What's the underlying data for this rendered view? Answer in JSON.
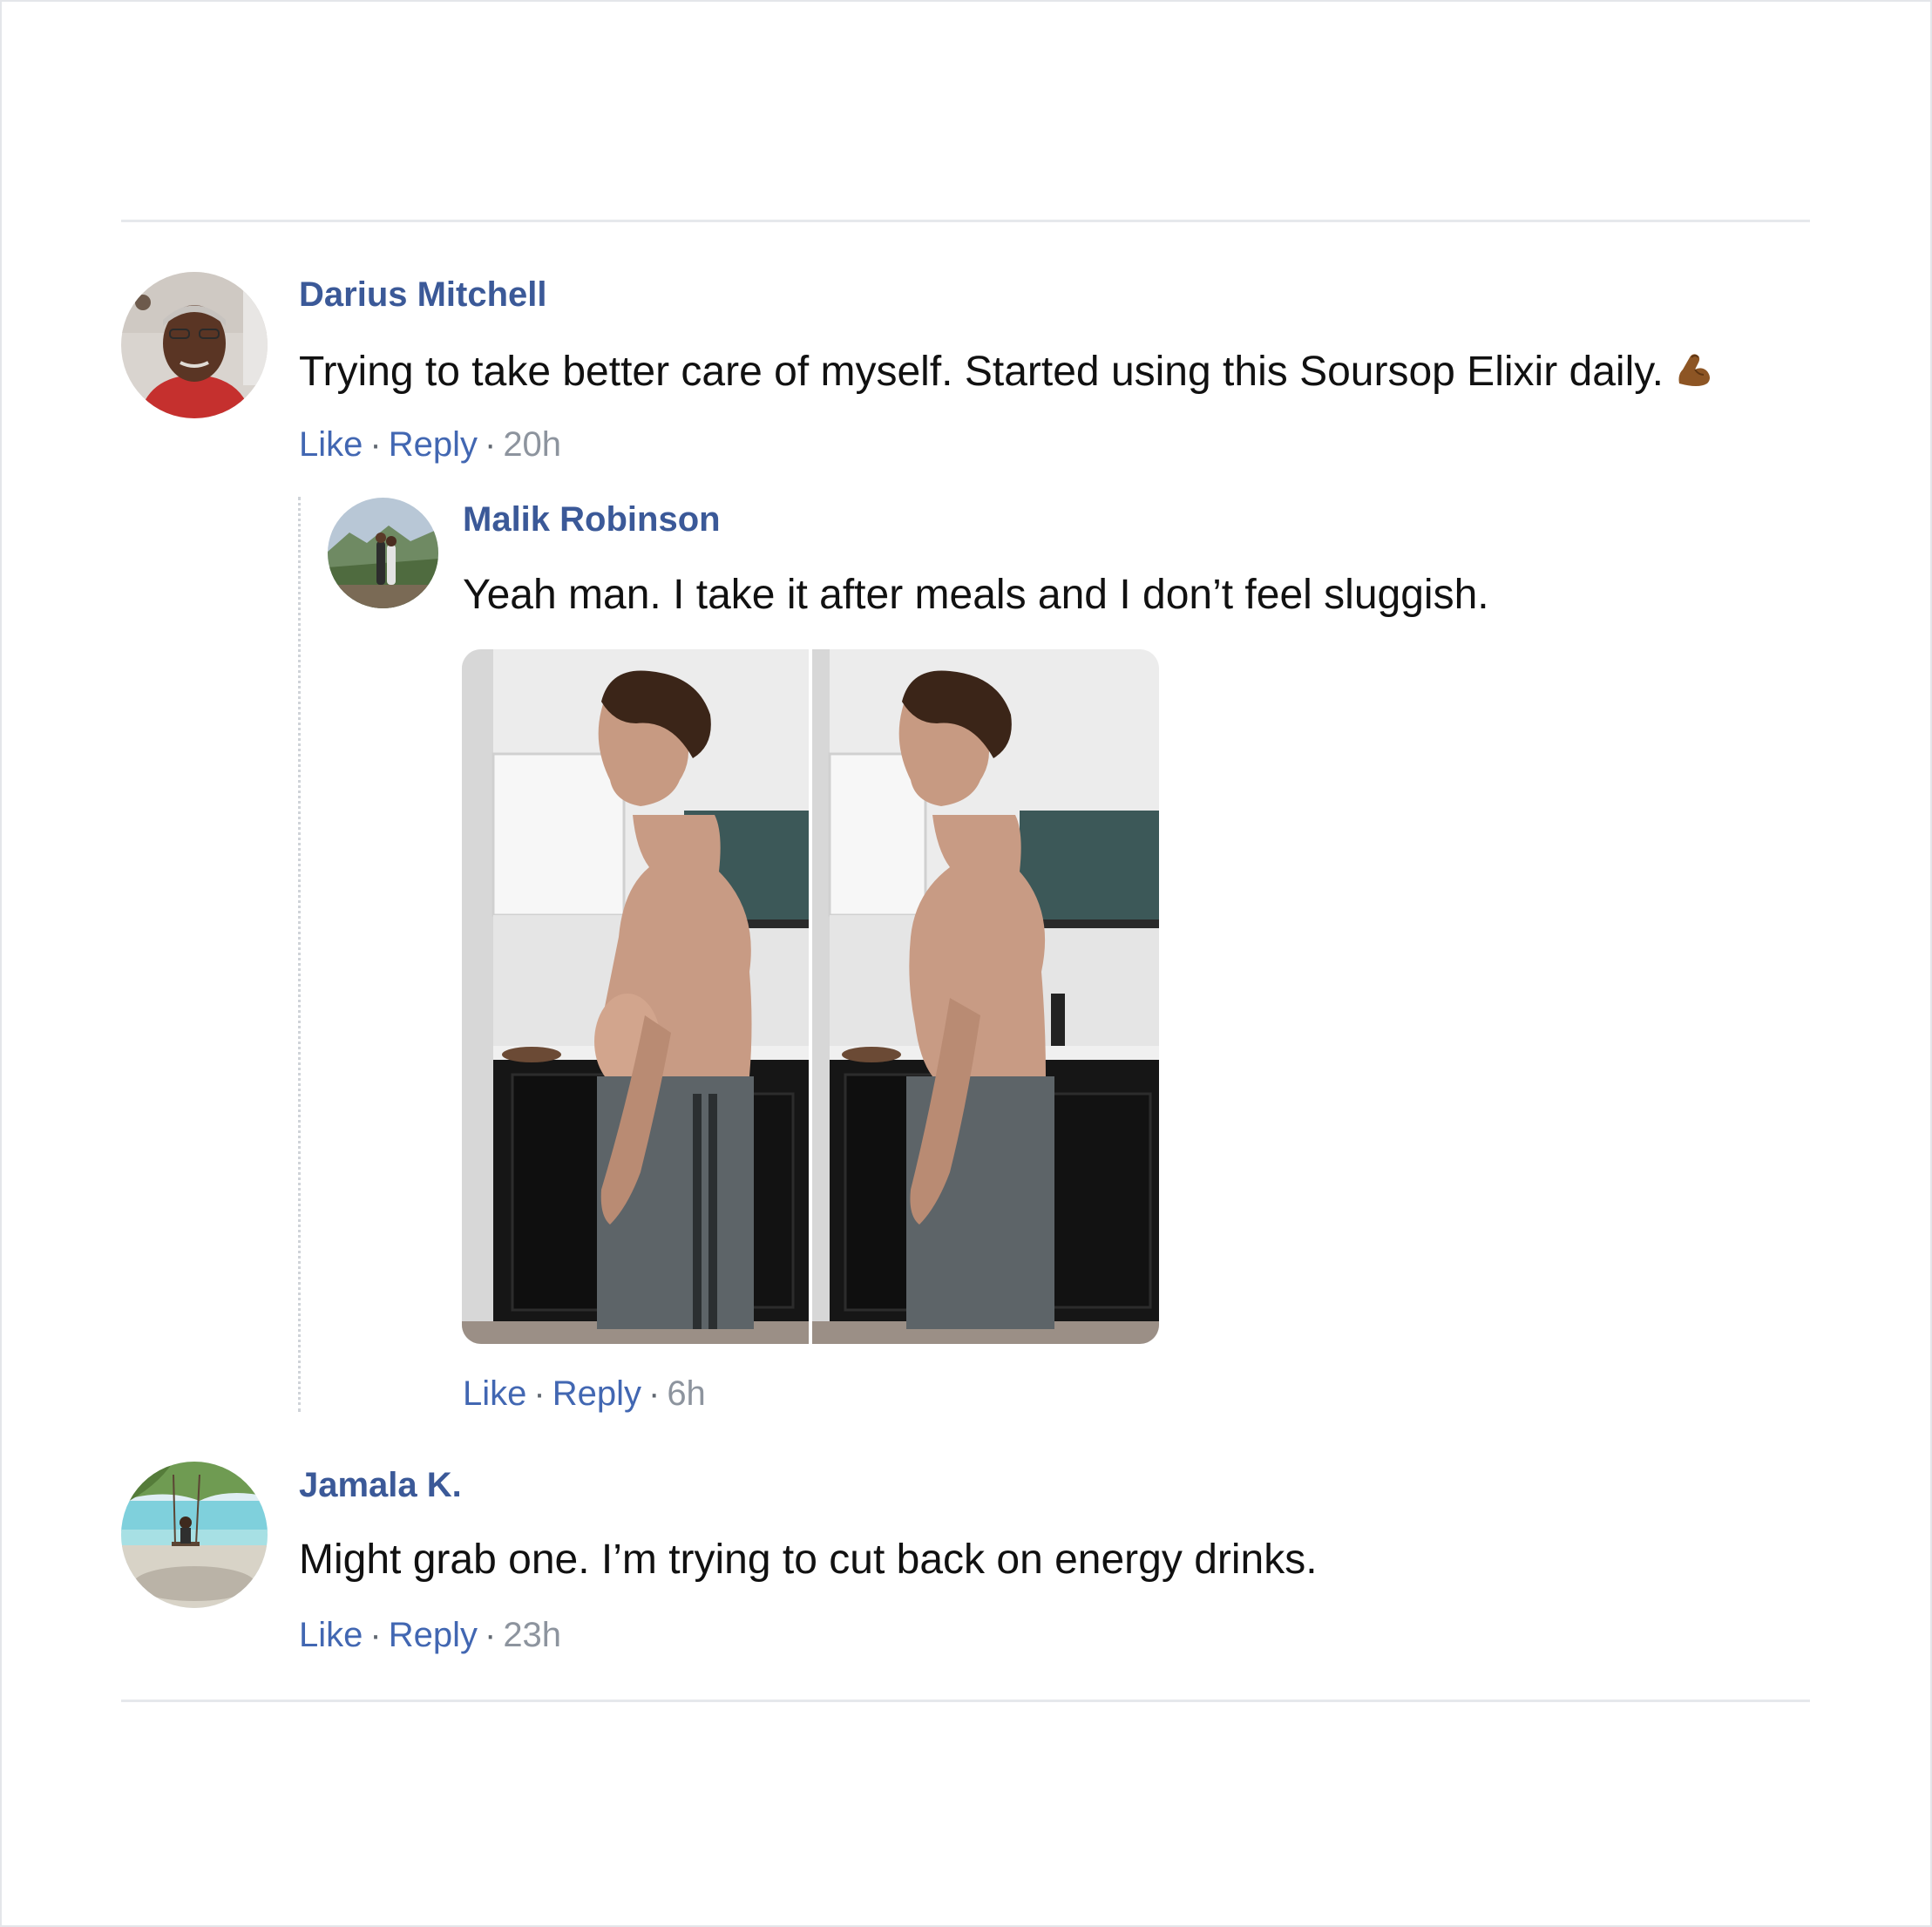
{
  "comments": [
    {
      "author": "Darius Mitchell",
      "text": "Trying to take better care of myself. Started using this Soursop Elixir daily.",
      "emoji": "flexed-biceps-emoji",
      "actions": {
        "like": "Like",
        "reply": "Reply",
        "sep": "·",
        "time": "20h"
      },
      "replies": [
        {
          "author": "Malik Robinson",
          "text": "Yeah man. I take it after meals and I don’t feel sluggish.",
          "image": "before-after-side-profile-photo",
          "actions": {
            "like": "Like",
            "reply": "Reply",
            "sep": "·",
            "time": "6h"
          }
        }
      ]
    },
    {
      "author": "Jamala K.",
      "text": "Might grab one. I’m trying to cut back on energy drinks.",
      "actions": {
        "like": "Like",
        "reply": "Reply",
        "sep": "·",
        "time": "23h"
      }
    }
  ],
  "colors": {
    "name": "#3b5998",
    "link": "#4267b2",
    "meta": "#8d949e",
    "text": "#111111",
    "divider": "#e6e8ec"
  }
}
